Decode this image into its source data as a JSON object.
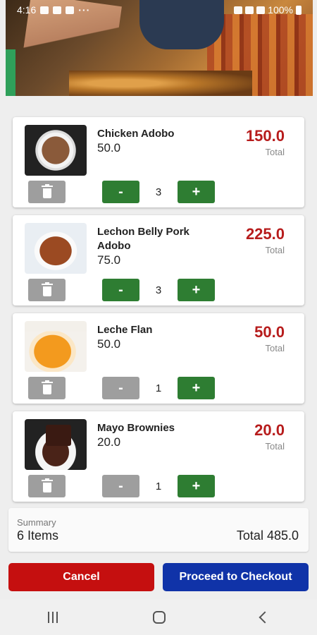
{
  "status_bar": {
    "time": "4:16",
    "dots": "···",
    "battery": "100%",
    "icons": [
      "image-icon",
      "twitter-icon",
      "gallery-icon",
      "mute-icon",
      "wifi-icon",
      "signal-icon",
      "battery-icon"
    ]
  },
  "cart": {
    "items": [
      {
        "name": "Chicken Adobo",
        "price": "50.0",
        "total": "150.0",
        "total_label": "Total",
        "quantity": "3",
        "minus": "-",
        "plus": "+",
        "image": "chicken-adobo"
      },
      {
        "name": "Lechon Belly Pork Adobo",
        "price": "75.0",
        "total": "225.0",
        "total_label": "Total",
        "quantity": "3",
        "minus": "-",
        "plus": "+",
        "image": "lechon-belly-pork-adobo"
      },
      {
        "name": "Leche Flan",
        "price": "50.0",
        "total": "50.0",
        "total_label": "Total",
        "quantity": "1",
        "minus": "-",
        "plus": "+",
        "image": "leche-flan"
      },
      {
        "name": "Mayo Brownies",
        "price": "20.0",
        "total": "20.0",
        "total_label": "Total",
        "quantity": "1",
        "minus": "-",
        "plus": "+",
        "image": "mayo-brownies"
      }
    ]
  },
  "summary": {
    "label": "Summary",
    "items": "6 Items",
    "total": "Total 485.0"
  },
  "actions": {
    "cancel": "Cancel",
    "checkout": "Proceed to Checkout"
  },
  "colors": {
    "total_red": "#b71c1c",
    "stepper_green": "#2e7d32",
    "disabled_grey": "#9e9e9e",
    "cancel_red": "#c50f0f",
    "checkout_blue": "#1033a8"
  }
}
